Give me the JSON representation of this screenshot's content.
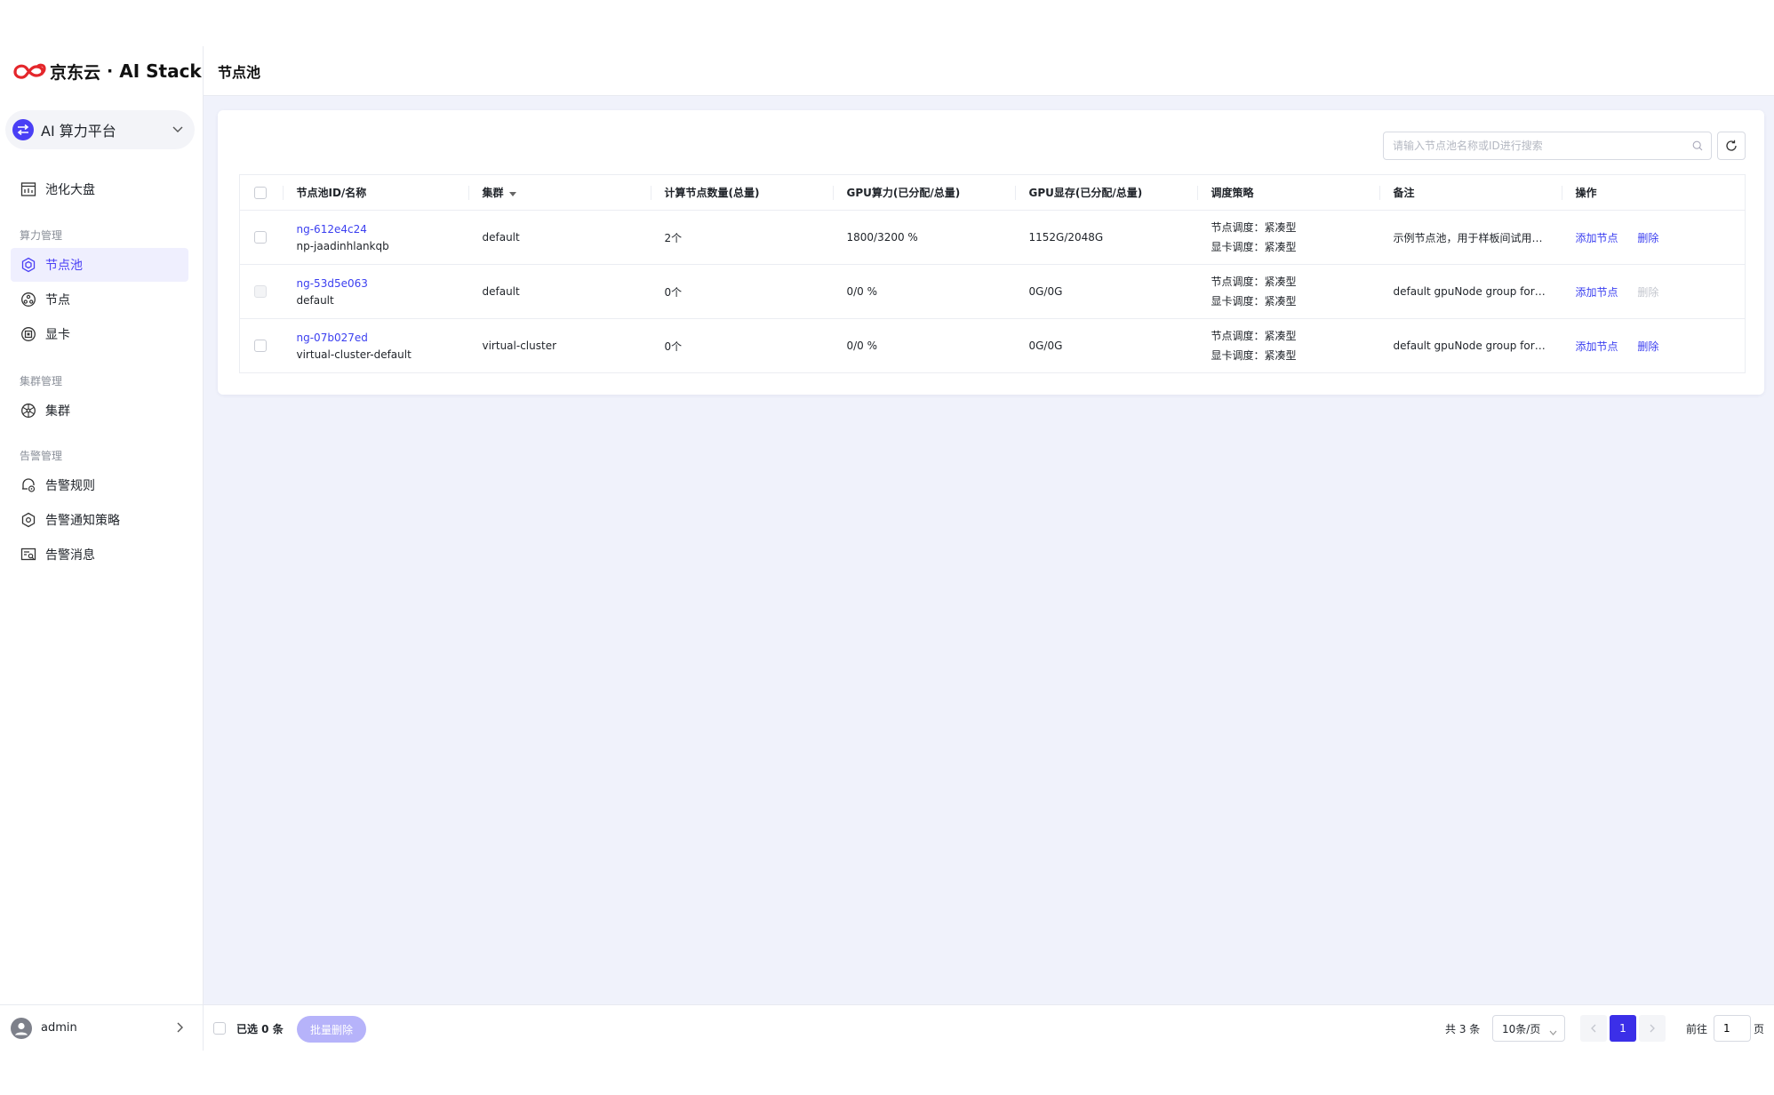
{
  "brand": {
    "name_cn": "京东云",
    "separator": "·",
    "product": "AI Stack",
    "accent": "#e4262b"
  },
  "platform": {
    "label": "AI 算力平台",
    "icon": "swap-icon",
    "accent": "#4a3ff5"
  },
  "nav": {
    "dashboard": {
      "label": "池化大盘",
      "icon": "dashboard-icon"
    },
    "groups": [
      {
        "title": "算力管理",
        "items": [
          {
            "label": "节点池",
            "icon": "node-pool-icon",
            "active": true
          },
          {
            "label": "节点",
            "icon": "node-icon"
          },
          {
            "label": "显卡",
            "icon": "gpu-icon"
          }
        ]
      },
      {
        "title": "集群管理",
        "items": [
          {
            "label": "集群",
            "icon": "cluster-icon"
          }
        ]
      },
      {
        "title": "告警管理",
        "items": [
          {
            "label": "告警规则",
            "icon": "alert-rule-icon"
          },
          {
            "label": "告警通知策略",
            "icon": "alert-policy-icon"
          },
          {
            "label": "告警消息",
            "icon": "alert-message-icon"
          }
        ]
      }
    ]
  },
  "user": {
    "name": "admin"
  },
  "page": {
    "title": "节点池"
  },
  "toolbar": {
    "search_placeholder": "请输入节点池名称或ID进行搜索",
    "search_value": ""
  },
  "table": {
    "headers": [
      "节点池ID/名称",
      "集群",
      "计算节点数量(总量)",
      "GPU算力(已分配/总量)",
      "GPU显存(已分配/总量)",
      "调度策略",
      "备注",
      "操作"
    ],
    "rows": [
      {
        "id": "ng-612e4c24",
        "name": "np-jaadinhlankqb",
        "cluster": "default",
        "nodes": "2个",
        "gpu_compute": "1800/3200 %",
        "gpu_mem": "1152G/2048G",
        "node_sched": "节点调度：紧凑型",
        "gpu_sched": "显卡调度：紧凑型",
        "remark": "示例节点池，用于样板间试用（...",
        "add_label": "添加节点",
        "delete_label": "删除",
        "delete_disabled": false,
        "check_disabled": false
      },
      {
        "id": "ng-53d5e063",
        "name": "default",
        "cluster": "default",
        "nodes": "0个",
        "gpu_compute": "0/0 %",
        "gpu_mem": "0G/0G",
        "node_sched": "节点调度：紧凑型",
        "gpu_sched": "显卡调度：紧凑型",
        "remark": "default gpuNode group for ho...",
        "add_label": "添加节点",
        "delete_label": "删除",
        "delete_disabled": true,
        "check_disabled": true
      },
      {
        "id": "ng-07b027ed",
        "name": "virtual-cluster-default",
        "cluster": "virtual-cluster",
        "nodes": "0个",
        "gpu_compute": "0/0 %",
        "gpu_mem": "0G/0G",
        "node_sched": "节点调度：紧凑型",
        "gpu_sched": "显卡调度：紧凑型",
        "remark": "default gpuNode group for sin...",
        "add_label": "添加节点",
        "delete_label": "删除",
        "delete_disabled": false,
        "check_disabled": false
      }
    ]
  },
  "footer": {
    "selected": "已选 0 条",
    "batch_delete": "批量删除",
    "total": "共 3 条",
    "page_size": "10条/页",
    "current_page": "1",
    "goto_label": "前往",
    "goto_value": "1",
    "page_unit": "页"
  }
}
